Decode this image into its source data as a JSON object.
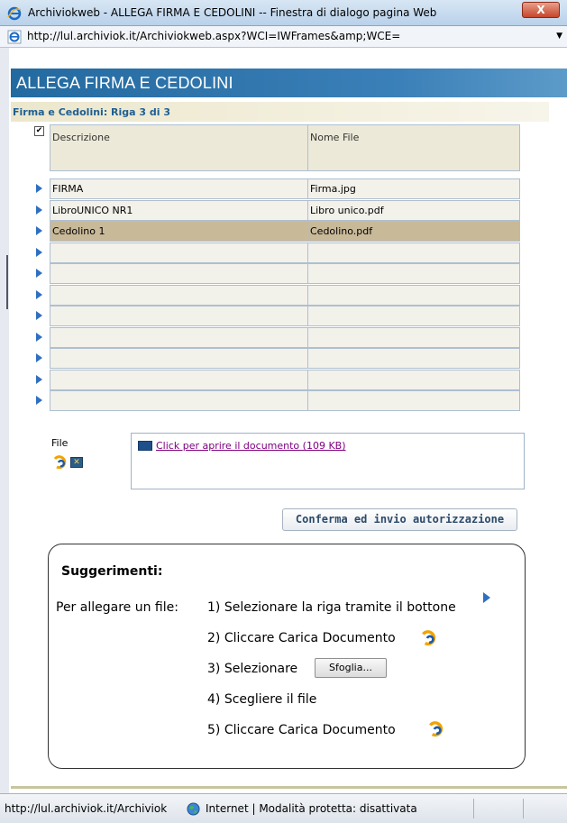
{
  "window": {
    "title": "Archiviokweb - ALLEGA FIRMA E CEDOLINI -- Finestra di dialogo pagina Web",
    "close_label": "X",
    "address": "http://lul.archiviok.it/Archiviokweb.aspx?WCI=IWFrames&amp;WCE=",
    "dropdown_glyph": "▼"
  },
  "page": {
    "banner_title": "ALLEGA FIRMA E CEDOLINI",
    "subheader": "Firma e Cedolini: Riga 3 di 3"
  },
  "grid": {
    "select_all_glyph": "✔",
    "columns": [
      "Descrizione",
      "Nome File"
    ],
    "rows": [
      {
        "descrizione": "FIRMA",
        "nome_file": "Firma.jpg"
      },
      {
        "descrizione": "LibroUNICO NR1",
        "nome_file": "Libro unico.pdf"
      },
      {
        "descrizione": "Cedolino 1",
        "nome_file": "Cedolino.pdf"
      },
      {
        "descrizione": "",
        "nome_file": ""
      },
      {
        "descrizione": "",
        "nome_file": ""
      },
      {
        "descrizione": "",
        "nome_file": ""
      },
      {
        "descrizione": "",
        "nome_file": ""
      },
      {
        "descrizione": "",
        "nome_file": ""
      },
      {
        "descrizione": "",
        "nome_file": ""
      },
      {
        "descrizione": "",
        "nome_file": ""
      },
      {
        "descrizione": "",
        "nome_file": ""
      }
    ],
    "selected_row": 2
  },
  "file": {
    "label": "File",
    "remove_glyph": "✕",
    "link_text": "Click per aprire il documento (109 KB)"
  },
  "confirm_button": "Conferma ed invio autorizzazione",
  "tips": {
    "title": "Suggerimenti:",
    "intro": "Per allegare un file:",
    "step1": "1) Selezionare la riga tramite il bottone",
    "step2": "2) Cliccare Carica Documento",
    "step3": "3) Selezionare",
    "browse_label": "Sfoglia...",
    "step4": "4) Scegliere il file",
    "step5": "5) Cliccare Carica Documento"
  },
  "status": {
    "url": "http://lul.archiviok.it/Archiviok",
    "zone": "Internet | Modalità protetta: disattivata"
  },
  "colors": {
    "banner": "#236aa0",
    "selected_row": "#c8b999",
    "link": "#800080",
    "accent_arrow": "#2f6fc0"
  }
}
